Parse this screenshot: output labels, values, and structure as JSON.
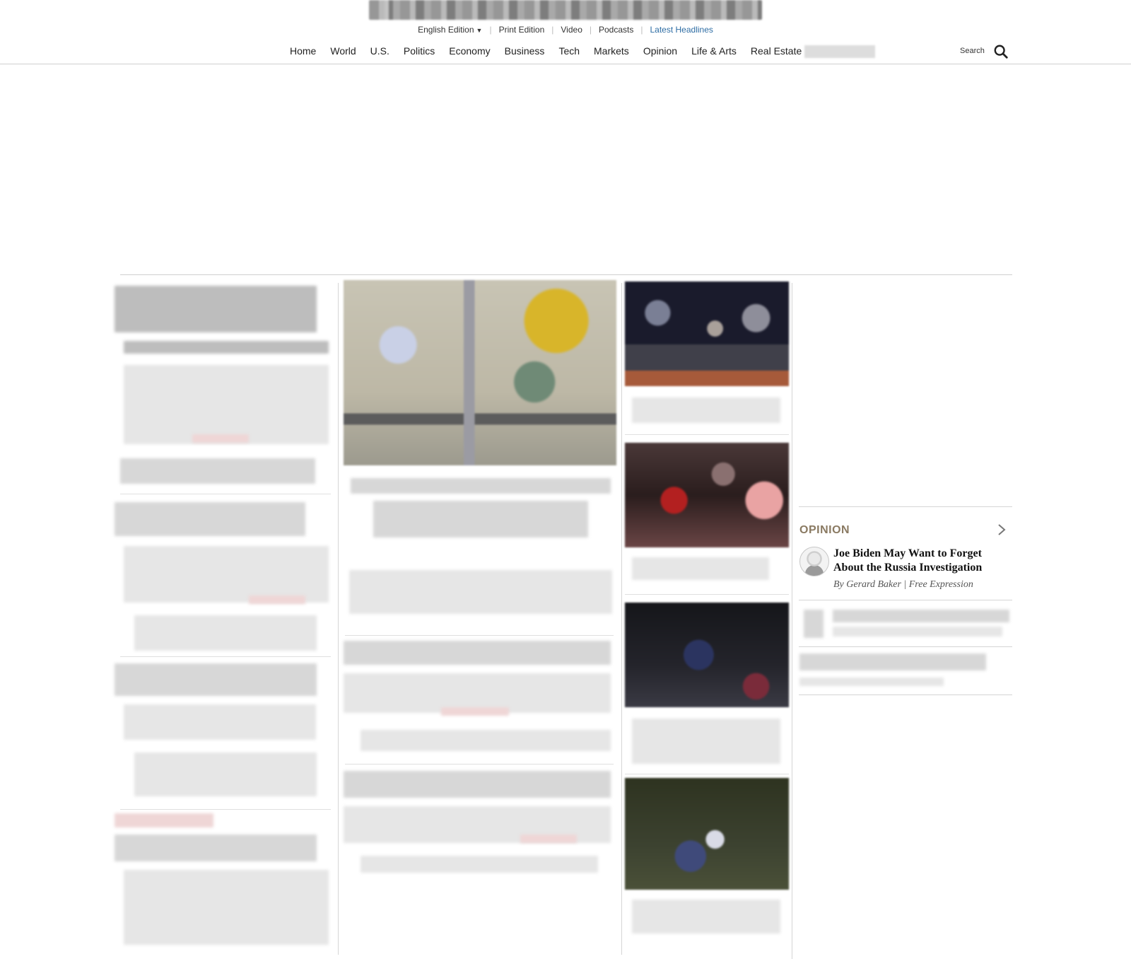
{
  "edition_links": {
    "edition": "English Edition",
    "print": "Print Edition",
    "video": "Video",
    "podcasts": "Podcasts",
    "latest": "Latest Headlines"
  },
  "nav": {
    "items": [
      "Home",
      "World",
      "U.S.",
      "Politics",
      "Economy",
      "Business",
      "Tech",
      "Markets",
      "Opinion",
      "Life & Arts",
      "Real Estate"
    ],
    "search_label": "Search"
  },
  "opinion": {
    "section_label": "OPINION",
    "headline": "Joe Biden May Want to Forget About the Russia Investigation",
    "byline": "By Gerard Baker | Free Expression"
  },
  "icons": {
    "search": "search-icon",
    "chevron": "chevron-right-icon",
    "dropdown": "caret-down-icon"
  }
}
